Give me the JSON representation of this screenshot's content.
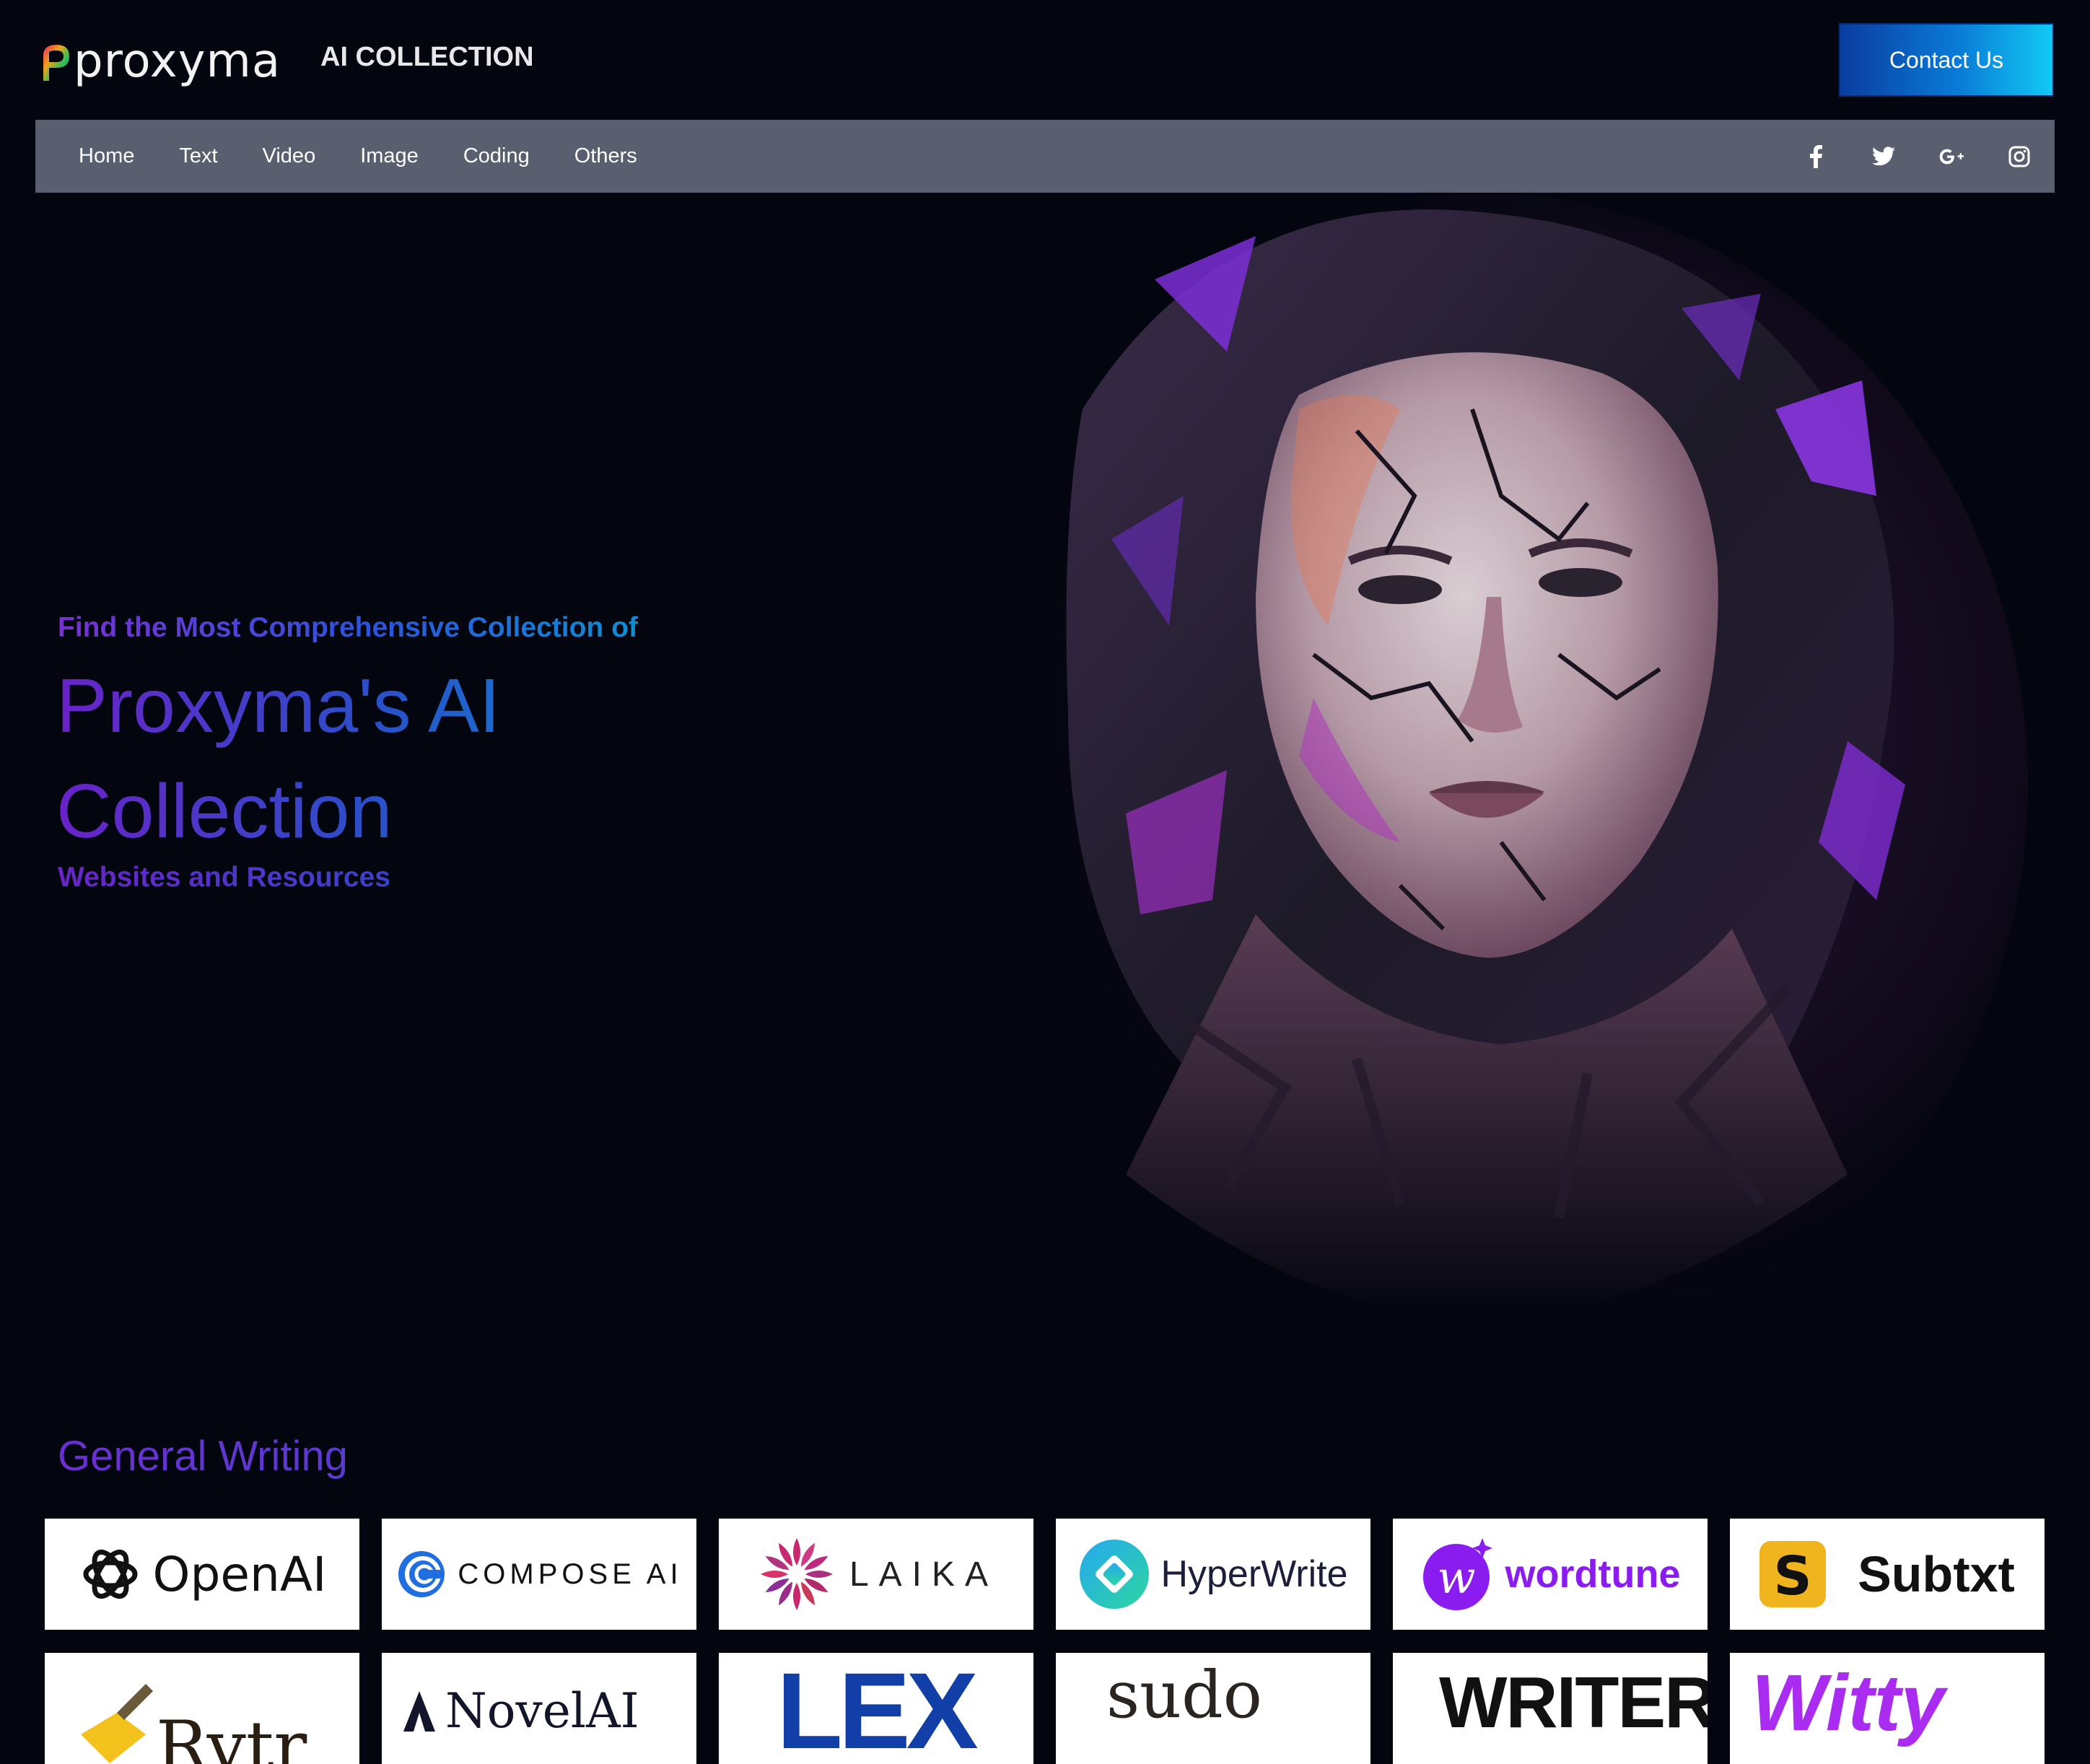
{
  "header": {
    "logo_text": "proxyma",
    "tagline": "AI COLLECTION",
    "contact_label": "Contact Us"
  },
  "nav": {
    "items": [
      "Home",
      "Text",
      "Video",
      "Image",
      "Coding",
      "Others"
    ],
    "social_icons": [
      "facebook-icon",
      "twitter-icon",
      "google-plus-icon",
      "instagram-icon"
    ]
  },
  "hero": {
    "eyebrow": "Find the Most Comprehensive Collection of",
    "title": "Proxyma's AI Collection",
    "subtitle": "Websites and Resources"
  },
  "section": {
    "title": "General Writing",
    "tools": [
      {
        "name": "OpenAI"
      },
      {
        "name": "COMPOSE AI"
      },
      {
        "name": "LAIKA"
      },
      {
        "name": "HyperWrite"
      },
      {
        "name": "wordtune"
      },
      {
        "name": "Subtxt"
      },
      {
        "name": "Rytr"
      },
      {
        "name": "NovelAI"
      },
      {
        "name": "LEX"
      },
      {
        "name": "sudo"
      },
      {
        "name": "WRITER"
      },
      {
        "name": "Witty"
      }
    ]
  },
  "colors": {
    "background": "#03050f",
    "nav_bar": "#5a5f70",
    "contact_gradient_start": "#0a3da0",
    "contact_gradient_end": "#12c9f4",
    "heading_purple": "#6a22c8",
    "heading_blue": "#0d86d4"
  }
}
